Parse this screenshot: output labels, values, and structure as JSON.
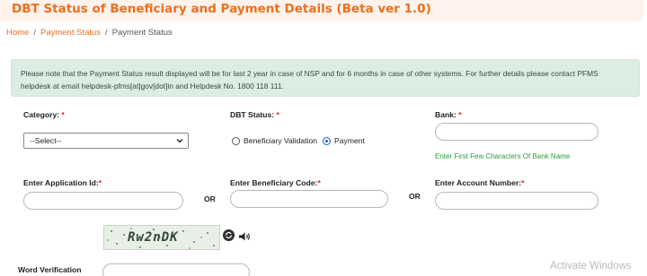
{
  "header": {
    "title": "DBT Status of Beneficiary and Payment Details (Beta ver 1.0)"
  },
  "breadcrumb": {
    "home": "Home",
    "section": "Payment Status",
    "current": "Payment Status",
    "separator": "/"
  },
  "notice": {
    "text": "Please note that the Payment Status result displayed will be for last 2 year in case of NSP and for 6 months in case of other systems. For further details please contact PFMS helpdesk at email helpdesk-pfms[at]gov[dot]in and Helpdesk No. 1800 118 111."
  },
  "form": {
    "required_mark": "*",
    "category": {
      "label": "Category:",
      "selected": "--Select--"
    },
    "dbt_status": {
      "label": "DBT Status:",
      "options": [
        {
          "label": "Beneficiary Validation",
          "checked": false
        },
        {
          "label": "Payment",
          "checked": true
        }
      ]
    },
    "bank": {
      "label": "Bank:",
      "hint": "Enter First Few Characters Of Bank Name"
    },
    "application_id": {
      "label": "Enter Application Id:"
    },
    "beneficiary_code": {
      "label": "Enter Beneficiary Code:"
    },
    "account_number": {
      "label": "Enter Account Number:"
    },
    "or_label": "OR",
    "captcha": {
      "text": "Rw2nDK",
      "refresh_icon": "refresh-icon",
      "audio_icon": "speaker-icon"
    },
    "word_verification": {
      "label": "Word Verification"
    }
  },
  "watermark": "Activate Windows",
  "colors": {
    "accent": "#ef6f1c",
    "notice_bg": "#dbeee1",
    "hint": "#2e9a3e",
    "required": "#e02020"
  }
}
